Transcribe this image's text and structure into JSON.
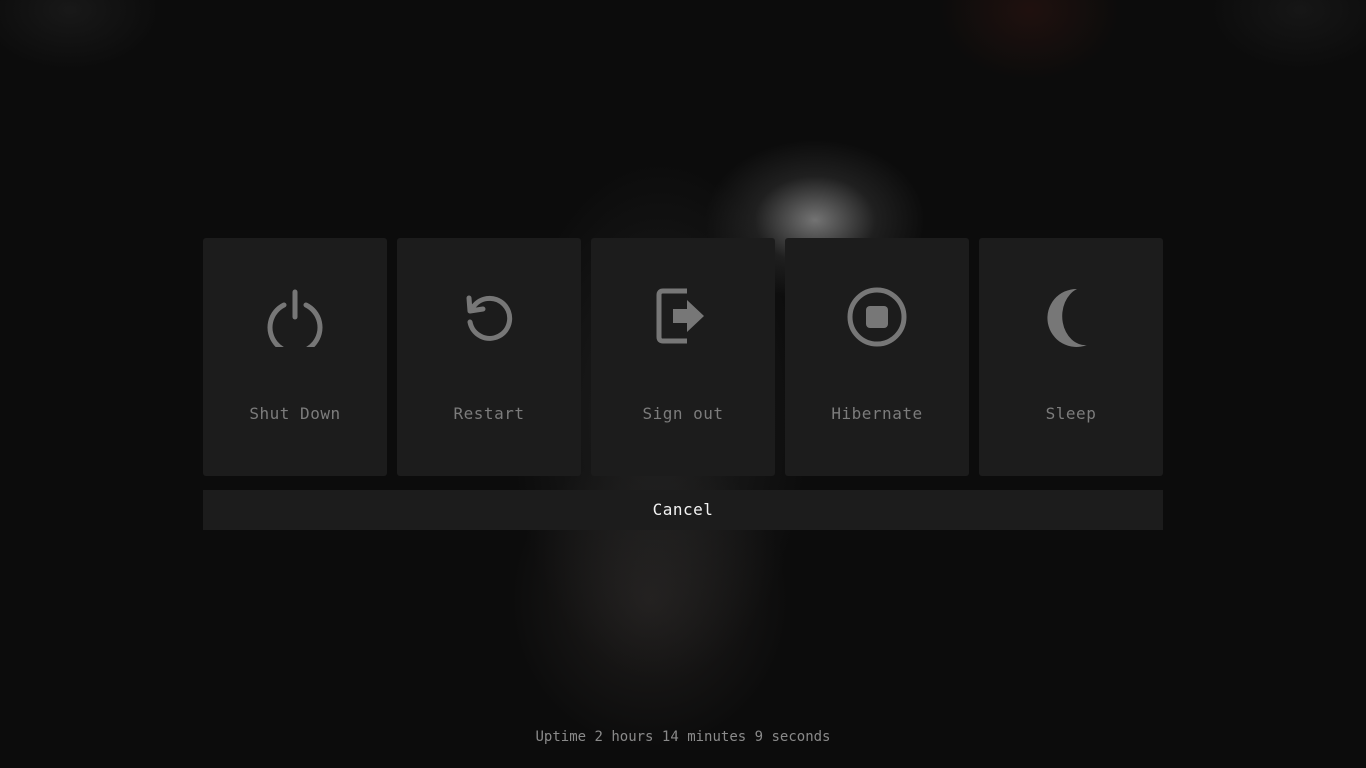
{
  "options": [
    {
      "label": "Shut Down",
      "icon": "power-icon"
    },
    {
      "label": "Restart",
      "icon": "restart-icon"
    },
    {
      "label": "Sign out",
      "icon": "sign-out-icon"
    },
    {
      "label": "Hibernate",
      "icon": "hibernate-icon"
    },
    {
      "label": "Sleep",
      "icon": "moon-icon"
    }
  ],
  "cancel_label": "Cancel",
  "uptime_text": "Uptime 2 hours 14 minutes 9 seconds",
  "colors": {
    "tile_background": "#1c1c1c",
    "icon_color": "#777777",
    "label_color": "#7c7c7c",
    "cancel_text": "#f2f2f2"
  }
}
